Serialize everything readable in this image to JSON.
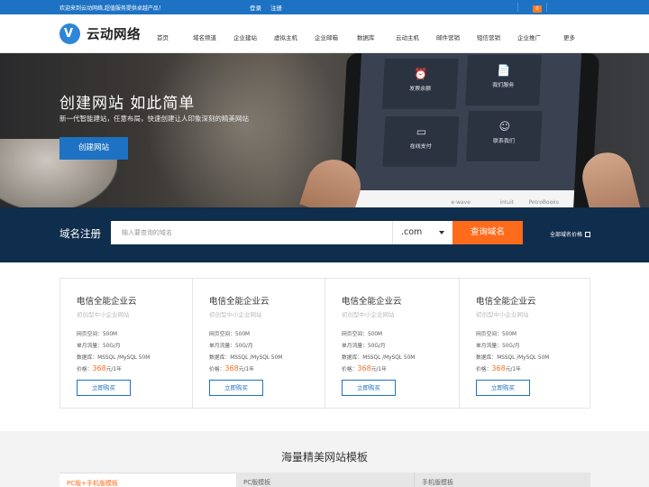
{
  "topbar": {
    "welcome": "欢迎来到云动网络,超值服务提供卓越产品！",
    "login": "登录",
    "register": "注册",
    "cart_count": "0"
  },
  "header": {
    "logo_text": "云动网络",
    "nav": [
      "首页",
      "域名频道",
      "企业建站",
      "虚拟主机",
      "企业邮箱",
      "数据库",
      "云动主机",
      "邮件营销",
      "短信营销",
      "企业推广",
      "更多"
    ]
  },
  "hero": {
    "title": "创建网站 如此简单",
    "subtitle": "新一代智能建站，任意布局，快速创建让人印象深刻的精美网站",
    "button": "创建网站",
    "tiles": [
      {
        "label": "发票余额",
        "icon": "alarm-icon"
      },
      {
        "label": "我们服务",
        "icon": "document-icon"
      },
      {
        "label": "在线支付",
        "icon": "card-icon"
      },
      {
        "label": "联系我们",
        "icon": "person-icon"
      }
    ],
    "partners": [
      "e·wave",
      "intuit",
      "PetroBooks"
    ]
  },
  "domain": {
    "label": "域名注册",
    "placeholder": "输入要查询的域名",
    "suffix": ".com",
    "search_button": "查询域名",
    "all_prices": "全部域名价格"
  },
  "products": [
    {
      "title": "电信全能企业云",
      "subtitle": "初创型中小企业网站",
      "space": "网页空间：500M",
      "traffic": "单月流量：50G/月",
      "db": "数据库：MSSQL /MySQL 50M",
      "price_label": "价格：",
      "price": "368",
      "unit": "元/1年",
      "buy": "立即购买"
    },
    {
      "title": "电信全能企业云",
      "subtitle": "初创型中小企业网站",
      "space": "网页空间：500M",
      "traffic": "单月流量：50G/月",
      "db": "数据库：MSSQL /MySQL 50M",
      "price_label": "价格：",
      "price": "368",
      "unit": "元/1年",
      "buy": "立即购买"
    },
    {
      "title": "电信全能企业云",
      "subtitle": "初创型中小企业网站",
      "space": "网页空间：500M",
      "traffic": "单月流量：50G/月",
      "db": "数据库：MSSQL /MySQL 50M",
      "price_label": "价格：",
      "price": "368",
      "unit": "元/1年",
      "buy": "立即购买"
    },
    {
      "title": "电信全能企业云",
      "subtitle": "初创型中小企业网站",
      "space": "网页空间：500M",
      "traffic": "单月流量：50G/月",
      "db": "数据库：MSSQL /MySQL 50M",
      "price_label": "价格：",
      "price": "368",
      "unit": "元/1年",
      "buy": "立即购买"
    }
  ],
  "templates": {
    "title": "海量精美网站模板",
    "tabs": [
      "PC版+手机版模板",
      "PC版模板",
      "手机版模板"
    ]
  },
  "colors": {
    "primary": "#1e72c3",
    "accent": "#ff6b1a",
    "domain_bg": "#0f2d4c"
  }
}
